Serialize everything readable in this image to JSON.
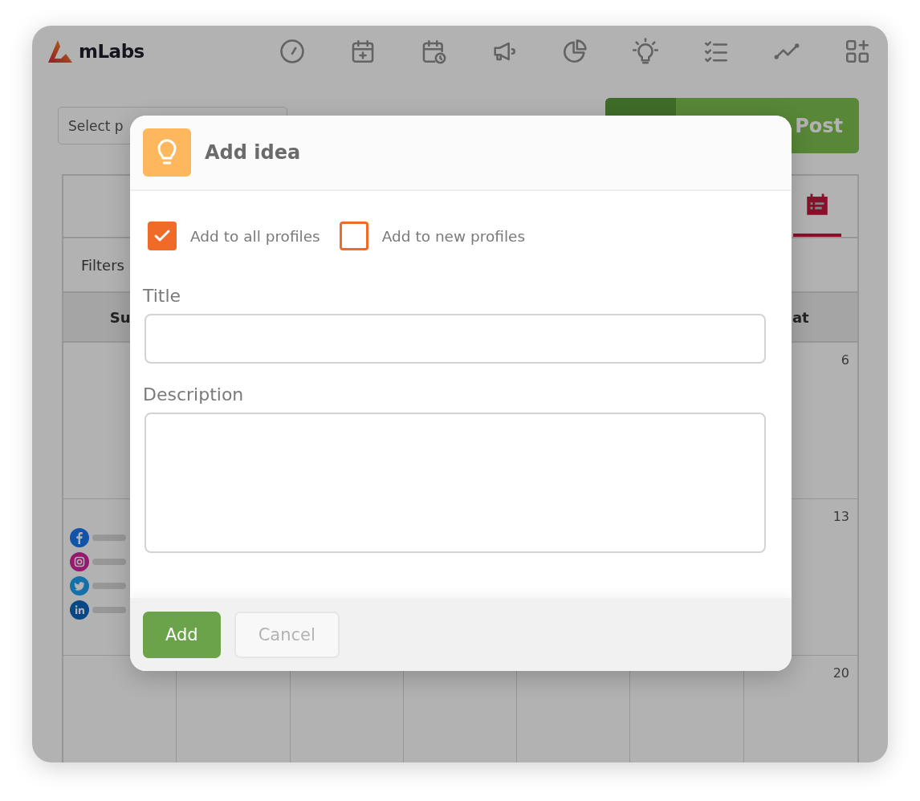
{
  "app": {
    "logo": "mLabs"
  },
  "profile_select": {
    "placeholder": "Select p"
  },
  "post_button": {
    "label": "Post"
  },
  "view_tabs": [
    {
      "kind": "calendar",
      "selected": true
    }
  ],
  "filters": {
    "label": "Filters"
  },
  "day_header": {
    "column_1": "Su",
    "column_7": "at"
  },
  "weeks": [
    {
      "last_day": "6"
    },
    {
      "last_day": "13",
      "posts": [
        {
          "kind": "facebook"
        },
        {
          "kind": "instagram"
        },
        {
          "kind": "twitter"
        },
        {
          "kind": "linkedin"
        }
      ]
    },
    {
      "last_day": "20"
    }
  ],
  "modal": {
    "title": "Add idea",
    "options": [
      {
        "label": "Add to all profiles",
        "checked": true
      },
      {
        "label": "Add to new profiles",
        "checked": false
      }
    ],
    "fields": [
      {
        "label": "Title",
        "kind": "input"
      },
      {
        "label": "Description",
        "kind": "textarea"
      }
    ],
    "buttons": [
      {
        "label": "Add",
        "kind": "primary"
      },
      {
        "label": "Cancel",
        "kind": "secondary"
      }
    ]
  }
}
